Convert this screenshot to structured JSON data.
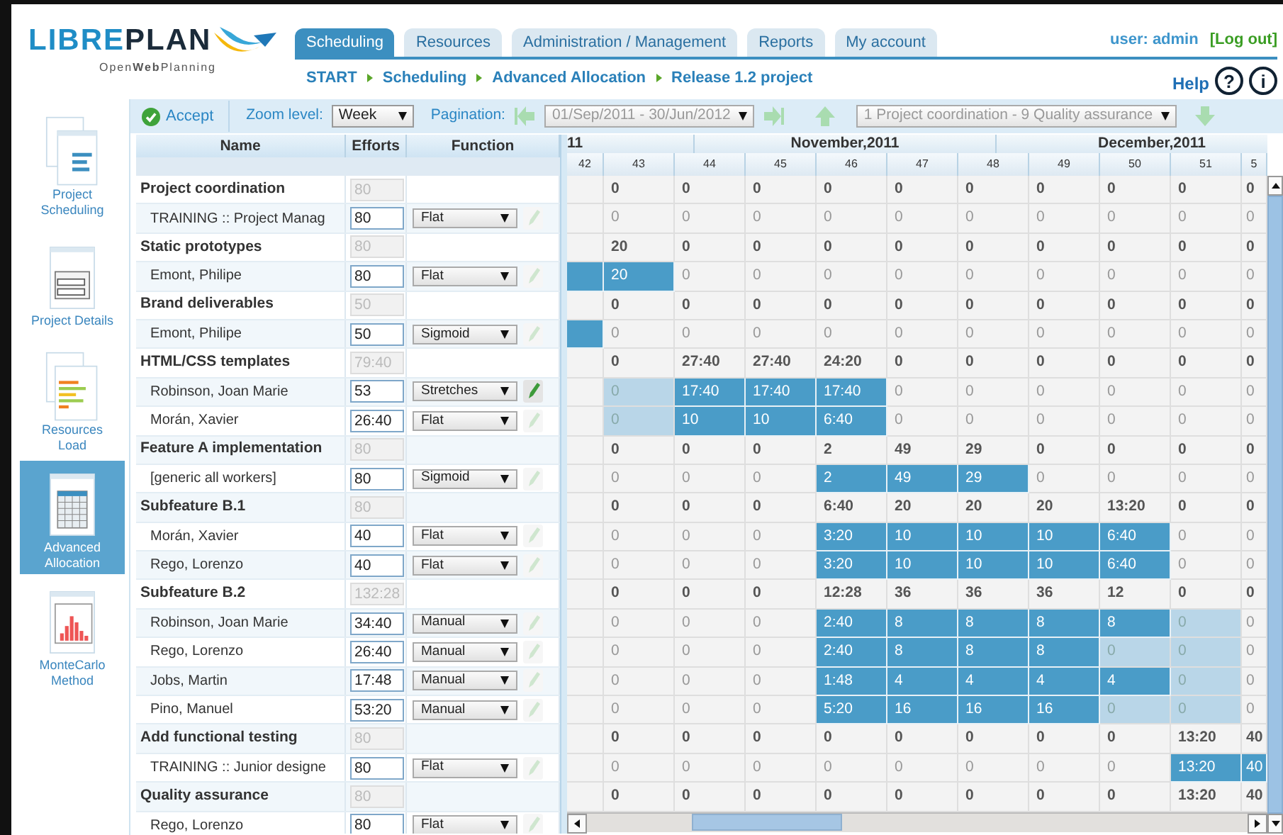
{
  "header": {
    "logo": {
      "part1": "LIBRE",
      "part2": "PLAN",
      "tagline": "Open**Web**Planning"
    },
    "tabs": [
      {
        "label": "Scheduling",
        "selected": true
      },
      {
        "label": "Resources",
        "selected": false
      },
      {
        "label": "Administration / Management",
        "selected": false
      },
      {
        "label": "Reports",
        "selected": false
      },
      {
        "label": "My account",
        "selected": false
      }
    ],
    "breadcrumb": [
      "START",
      "Scheduling",
      "Advanced Allocation",
      "Release 1.2 project"
    ],
    "user": "user: admin",
    "logout": "[Log out]",
    "help": {
      "label": "Help",
      "buttons": [
        "?",
        "i"
      ]
    }
  },
  "sidebar": {
    "items": [
      {
        "label": "Project\nScheduling",
        "selected": false
      },
      {
        "label": "Project Details",
        "selected": false
      },
      {
        "label": "Resources\nLoad",
        "selected": false
      },
      {
        "label": "Advanced\nAllocation",
        "selected": true
      },
      {
        "label": "MonteCarlo\nMethod",
        "selected": false
      }
    ]
  },
  "toolbar": {
    "accept": "Accept",
    "zoom_label": "Zoom level:",
    "zoom_value": "Week",
    "pagination_label": "Pagination:",
    "date_range": "01/Sep/2011 - 30/Jun/2012",
    "task_range": "1 Project coordination - 9 Quality assurance"
  },
  "table": {
    "columns": [
      "Name",
      "Efforts",
      "Function"
    ],
    "rows": [
      {
        "kind": "task",
        "name": "Project coordination",
        "effort": "80",
        "cells": [
          {
            "kind": "plain"
          },
          {
            "text": "0",
            "kind": "plain"
          },
          {
            "text": "0",
            "kind": "plain"
          },
          {
            "text": "0",
            "kind": "plain"
          },
          {
            "text": "0",
            "kind": "plain"
          },
          {
            "text": "0",
            "kind": "plain"
          },
          {
            "text": "0",
            "kind": "plain"
          },
          {
            "text": "0",
            "kind": "plain"
          },
          {
            "text": "0",
            "kind": "plain"
          },
          {
            "text": "0",
            "kind": "plain"
          },
          {
            "text": "0",
            "kind": "plain"
          }
        ]
      },
      {
        "kind": "resource",
        "name": "TRAINING :: Project Manag",
        "effort": "80",
        "function": "Flat",
        "edit_enabled": false,
        "cells": [
          {
            "kind": "plain"
          },
          {
            "text": "0",
            "kind": "plain"
          },
          {
            "text": "0",
            "kind": "plain"
          },
          {
            "text": "0",
            "kind": "plain"
          },
          {
            "text": "0",
            "kind": "plain"
          },
          {
            "text": "0",
            "kind": "plain"
          },
          {
            "text": "0",
            "kind": "plain"
          },
          {
            "text": "0",
            "kind": "plain"
          },
          {
            "text": "0",
            "kind": "plain"
          },
          {
            "text": "0",
            "kind": "plain"
          },
          {
            "text": "0",
            "kind": "plain"
          }
        ]
      },
      {
        "kind": "task",
        "name": "Static prototypes",
        "effort": "80",
        "cells": [
          {
            "kind": "plain"
          },
          {
            "text": "20",
            "kind": "plain"
          },
          {
            "text": "0",
            "kind": "plain"
          },
          {
            "text": "0",
            "kind": "plain"
          },
          {
            "text": "0",
            "kind": "plain"
          },
          {
            "text": "0",
            "kind": "plain"
          },
          {
            "text": "0",
            "kind": "plain"
          },
          {
            "text": "0",
            "kind": "plain"
          },
          {
            "text": "0",
            "kind": "plain"
          },
          {
            "text": "0",
            "kind": "plain"
          },
          {
            "text": "0",
            "kind": "plain"
          }
        ]
      },
      {
        "kind": "resource",
        "name": "Emont, Philipe",
        "effort": "80",
        "function": "Flat",
        "edit_enabled": false,
        "cells": [
          {
            "kind": "assigned"
          },
          {
            "text": "20",
            "kind": "assigned"
          },
          {
            "text": "0",
            "kind": "plain"
          },
          {
            "text": "0",
            "kind": "plain"
          },
          {
            "text": "0",
            "kind": "plain"
          },
          {
            "text": "0",
            "kind": "plain"
          },
          {
            "text": "0",
            "kind": "plain"
          },
          {
            "text": "0",
            "kind": "plain"
          },
          {
            "text": "0",
            "kind": "plain"
          },
          {
            "text": "0",
            "kind": "plain"
          },
          {
            "text": "0",
            "kind": "plain"
          }
        ]
      },
      {
        "kind": "task",
        "name": "Brand deliverables",
        "effort": "50",
        "cells": [
          {
            "kind": "plain"
          },
          {
            "text": "0",
            "kind": "plain"
          },
          {
            "text": "0",
            "kind": "plain"
          },
          {
            "text": "0",
            "kind": "plain"
          },
          {
            "text": "0",
            "kind": "plain"
          },
          {
            "text": "0",
            "kind": "plain"
          },
          {
            "text": "0",
            "kind": "plain"
          },
          {
            "text": "0",
            "kind": "plain"
          },
          {
            "text": "0",
            "kind": "plain"
          },
          {
            "text": "0",
            "kind": "plain"
          },
          {
            "text": "0",
            "kind": "plain"
          }
        ]
      },
      {
        "kind": "resource",
        "name": "Emont, Philipe",
        "effort": "50",
        "function": "Sigmoid",
        "edit_enabled": false,
        "cells": [
          {
            "kind": "assigned"
          },
          {
            "text": "0",
            "kind": "plain"
          },
          {
            "text": "0",
            "kind": "plain"
          },
          {
            "text": "0",
            "kind": "plain"
          },
          {
            "text": "0",
            "kind": "plain"
          },
          {
            "text": "0",
            "kind": "plain"
          },
          {
            "text": "0",
            "kind": "plain"
          },
          {
            "text": "0",
            "kind": "plain"
          },
          {
            "text": "0",
            "kind": "plain"
          },
          {
            "text": "0",
            "kind": "plain"
          },
          {
            "text": "0",
            "kind": "plain"
          }
        ]
      },
      {
        "kind": "task",
        "name": "HTML/CSS templates",
        "effort": "79:40",
        "cells": [
          {
            "kind": "plain"
          },
          {
            "text": "0",
            "kind": "plain"
          },
          {
            "text": "27:40",
            "kind": "plain"
          },
          {
            "text": "27:40",
            "kind": "plain"
          },
          {
            "text": "24:20",
            "kind": "plain"
          },
          {
            "text": "0",
            "kind": "plain"
          },
          {
            "text": "0",
            "kind": "plain"
          },
          {
            "text": "0",
            "kind": "plain"
          },
          {
            "text": "0",
            "kind": "plain"
          },
          {
            "text": "0",
            "kind": "plain"
          },
          {
            "text": "0",
            "kind": "plain"
          }
        ]
      },
      {
        "kind": "resource",
        "name": "Robinson, Joan Marie",
        "effort": "53",
        "function": "Stretches",
        "edit_enabled": true,
        "cells": [
          {
            "kind": "plain"
          },
          {
            "text": "0",
            "kind": "shaded"
          },
          {
            "text": "17:40",
            "kind": "assigned"
          },
          {
            "text": "17:40",
            "kind": "assigned"
          },
          {
            "text": "17:40",
            "kind": "assigned"
          },
          {
            "text": "0",
            "kind": "plain"
          },
          {
            "text": "0",
            "kind": "plain"
          },
          {
            "text": "0",
            "kind": "plain"
          },
          {
            "text": "0",
            "kind": "plain"
          },
          {
            "text": "0",
            "kind": "plain"
          },
          {
            "text": "0",
            "kind": "plain"
          }
        ]
      },
      {
        "kind": "resource",
        "name": "Morán, Xavier",
        "effort": "26:40",
        "function": "Flat",
        "edit_enabled": false,
        "cells": [
          {
            "kind": "plain"
          },
          {
            "text": "0",
            "kind": "shaded"
          },
          {
            "text": "10",
            "kind": "assigned"
          },
          {
            "text": "10",
            "kind": "assigned"
          },
          {
            "text": "6:40",
            "kind": "assigned"
          },
          {
            "text": "0",
            "kind": "plain"
          },
          {
            "text": "0",
            "kind": "plain"
          },
          {
            "text": "0",
            "kind": "plain"
          },
          {
            "text": "0",
            "kind": "plain"
          },
          {
            "text": "0",
            "kind": "plain"
          },
          {
            "text": "0",
            "kind": "plain"
          }
        ]
      },
      {
        "kind": "task",
        "name": "Feature A implementation",
        "effort": "80",
        "cells": [
          {
            "kind": "plain"
          },
          {
            "text": "0",
            "kind": "plain"
          },
          {
            "text": "0",
            "kind": "plain"
          },
          {
            "text": "0",
            "kind": "plain"
          },
          {
            "text": "2",
            "kind": "plain"
          },
          {
            "text": "49",
            "kind": "plain"
          },
          {
            "text": "29",
            "kind": "plain"
          },
          {
            "text": "0",
            "kind": "plain"
          },
          {
            "text": "0",
            "kind": "plain"
          },
          {
            "text": "0",
            "kind": "plain"
          },
          {
            "text": "0",
            "kind": "plain"
          }
        ]
      },
      {
        "kind": "resource",
        "name": "[generic all workers]",
        "effort": "80",
        "function": "Sigmoid",
        "edit_enabled": false,
        "cells": [
          {
            "kind": "plain"
          },
          {
            "text": "0",
            "kind": "plain"
          },
          {
            "text": "0",
            "kind": "plain"
          },
          {
            "text": "0",
            "kind": "plain"
          },
          {
            "text": "2",
            "kind": "assigned"
          },
          {
            "text": "49",
            "kind": "assigned"
          },
          {
            "text": "29",
            "kind": "assigned"
          },
          {
            "text": "0",
            "kind": "plain"
          },
          {
            "text": "0",
            "kind": "plain"
          },
          {
            "text": "0",
            "kind": "plain"
          },
          {
            "text": "0",
            "kind": "plain"
          }
        ]
      },
      {
        "kind": "task",
        "name": "Subfeature B.1",
        "effort": "80",
        "cells": [
          {
            "kind": "plain"
          },
          {
            "text": "0",
            "kind": "plain"
          },
          {
            "text": "0",
            "kind": "plain"
          },
          {
            "text": "0",
            "kind": "plain"
          },
          {
            "text": "6:40",
            "kind": "plain"
          },
          {
            "text": "20",
            "kind": "plain"
          },
          {
            "text": "20",
            "kind": "plain"
          },
          {
            "text": "20",
            "kind": "plain"
          },
          {
            "text": "13:20",
            "kind": "plain"
          },
          {
            "text": "0",
            "kind": "plain"
          },
          {
            "text": "0",
            "kind": "plain"
          }
        ]
      },
      {
        "kind": "resource",
        "name": "Morán, Xavier",
        "effort": "40",
        "function": "Flat",
        "edit_enabled": false,
        "cells": [
          {
            "kind": "plain"
          },
          {
            "text": "0",
            "kind": "plain"
          },
          {
            "text": "0",
            "kind": "plain"
          },
          {
            "text": "0",
            "kind": "plain"
          },
          {
            "text": "3:20",
            "kind": "assigned"
          },
          {
            "text": "10",
            "kind": "assigned"
          },
          {
            "text": "10",
            "kind": "assigned"
          },
          {
            "text": "10",
            "kind": "assigned"
          },
          {
            "text": "6:40",
            "kind": "assigned"
          },
          {
            "text": "0",
            "kind": "plain"
          },
          {
            "text": "0",
            "kind": "plain"
          }
        ]
      },
      {
        "kind": "resource",
        "name": "Rego, Lorenzo",
        "effort": "40",
        "function": "Flat",
        "edit_enabled": false,
        "cells": [
          {
            "kind": "plain"
          },
          {
            "text": "0",
            "kind": "plain"
          },
          {
            "text": "0",
            "kind": "plain"
          },
          {
            "text": "0",
            "kind": "plain"
          },
          {
            "text": "3:20",
            "kind": "assigned"
          },
          {
            "text": "10",
            "kind": "assigned"
          },
          {
            "text": "10",
            "kind": "assigned"
          },
          {
            "text": "10",
            "kind": "assigned"
          },
          {
            "text": "6:40",
            "kind": "assigned"
          },
          {
            "text": "0",
            "kind": "plain"
          },
          {
            "text": "0",
            "kind": "plain"
          }
        ]
      },
      {
        "kind": "task",
        "name": "Subfeature B.2",
        "effort": "132:28",
        "cells": [
          {
            "kind": "plain"
          },
          {
            "text": "0",
            "kind": "plain"
          },
          {
            "text": "0",
            "kind": "plain"
          },
          {
            "text": "0",
            "kind": "plain"
          },
          {
            "text": "12:28",
            "kind": "plain"
          },
          {
            "text": "36",
            "kind": "plain"
          },
          {
            "text": "36",
            "kind": "plain"
          },
          {
            "text": "36",
            "kind": "plain"
          },
          {
            "text": "12",
            "kind": "plain"
          },
          {
            "text": "0",
            "kind": "plain"
          },
          {
            "text": "0",
            "kind": "plain"
          }
        ]
      },
      {
        "kind": "resource",
        "name": "Robinson, Joan Marie",
        "effort": "34:40",
        "function": "Manual",
        "edit_enabled": false,
        "cells": [
          {
            "kind": "plain"
          },
          {
            "text": "0",
            "kind": "plain"
          },
          {
            "text": "0",
            "kind": "plain"
          },
          {
            "text": "0",
            "kind": "plain"
          },
          {
            "text": "2:40",
            "kind": "assigned"
          },
          {
            "text": "8",
            "kind": "assigned"
          },
          {
            "text": "8",
            "kind": "assigned"
          },
          {
            "text": "8",
            "kind": "assigned"
          },
          {
            "text": "8",
            "kind": "assigned"
          },
          {
            "text": "0",
            "kind": "shaded"
          },
          {
            "text": "0",
            "kind": "plain"
          }
        ]
      },
      {
        "kind": "resource",
        "name": "Rego, Lorenzo",
        "effort": "26:40",
        "function": "Manual",
        "edit_enabled": false,
        "cells": [
          {
            "kind": "plain"
          },
          {
            "text": "0",
            "kind": "plain"
          },
          {
            "text": "0",
            "kind": "plain"
          },
          {
            "text": "0",
            "kind": "plain"
          },
          {
            "text": "2:40",
            "kind": "assigned"
          },
          {
            "text": "8",
            "kind": "assigned"
          },
          {
            "text": "8",
            "kind": "assigned"
          },
          {
            "text": "8",
            "kind": "assigned"
          },
          {
            "text": "0",
            "kind": "shaded"
          },
          {
            "text": "0",
            "kind": "shaded"
          },
          {
            "text": "0",
            "kind": "plain"
          }
        ]
      },
      {
        "kind": "resource",
        "name": "Jobs, Martin",
        "effort": "17:48",
        "function": "Manual",
        "edit_enabled": false,
        "cells": [
          {
            "kind": "plain"
          },
          {
            "text": "0",
            "kind": "plain"
          },
          {
            "text": "0",
            "kind": "plain"
          },
          {
            "text": "0",
            "kind": "plain"
          },
          {
            "text": "1:48",
            "kind": "assigned"
          },
          {
            "text": "4",
            "kind": "assigned"
          },
          {
            "text": "4",
            "kind": "assigned"
          },
          {
            "text": "4",
            "kind": "assigned"
          },
          {
            "text": "4",
            "kind": "assigned"
          },
          {
            "text": "0",
            "kind": "shaded"
          },
          {
            "text": "0",
            "kind": "plain"
          }
        ]
      },
      {
        "kind": "resource",
        "name": "Pino, Manuel",
        "effort": "53:20",
        "function": "Manual",
        "edit_enabled": false,
        "cells": [
          {
            "kind": "plain"
          },
          {
            "text": "0",
            "kind": "plain"
          },
          {
            "text": "0",
            "kind": "plain"
          },
          {
            "text": "0",
            "kind": "plain"
          },
          {
            "text": "5:20",
            "kind": "assigned"
          },
          {
            "text": "16",
            "kind": "assigned"
          },
          {
            "text": "16",
            "kind": "assigned"
          },
          {
            "text": "16",
            "kind": "assigned"
          },
          {
            "text": "0",
            "kind": "shaded"
          },
          {
            "text": "0",
            "kind": "shaded"
          },
          {
            "text": "0",
            "kind": "plain"
          }
        ]
      },
      {
        "kind": "task",
        "name": "Add functional testing",
        "effort": "80",
        "cells": [
          {
            "kind": "plain"
          },
          {
            "text": "0",
            "kind": "plain"
          },
          {
            "text": "0",
            "kind": "plain"
          },
          {
            "text": "0",
            "kind": "plain"
          },
          {
            "text": "0",
            "kind": "plain"
          },
          {
            "text": "0",
            "kind": "plain"
          },
          {
            "text": "0",
            "kind": "plain"
          },
          {
            "text": "0",
            "kind": "plain"
          },
          {
            "text": "0",
            "kind": "plain"
          },
          {
            "text": "13:20",
            "kind": "plain"
          },
          {
            "text": "40",
            "kind": "plain"
          }
        ]
      },
      {
        "kind": "resource",
        "name": "TRAINING :: Junior designe",
        "effort": "80",
        "function": "Flat",
        "edit_enabled": false,
        "cells": [
          {
            "kind": "plain"
          },
          {
            "text": "0",
            "kind": "plain"
          },
          {
            "text": "0",
            "kind": "plain"
          },
          {
            "text": "0",
            "kind": "plain"
          },
          {
            "text": "0",
            "kind": "plain"
          },
          {
            "text": "0",
            "kind": "plain"
          },
          {
            "text": "0",
            "kind": "plain"
          },
          {
            "text": "0",
            "kind": "plain"
          },
          {
            "text": "0",
            "kind": "plain"
          },
          {
            "text": "13:20",
            "kind": "assigned"
          },
          {
            "text": "40",
            "kind": "assigned"
          }
        ]
      },
      {
        "kind": "task",
        "name": "Quality assurance",
        "effort": "80",
        "cells": [
          {
            "kind": "plain"
          },
          {
            "text": "0",
            "kind": "plain"
          },
          {
            "text": "0",
            "kind": "plain"
          },
          {
            "text": "0",
            "kind": "plain"
          },
          {
            "text": "0",
            "kind": "plain"
          },
          {
            "text": "0",
            "kind": "plain"
          },
          {
            "text": "0",
            "kind": "plain"
          },
          {
            "text": "0",
            "kind": "plain"
          },
          {
            "text": "0",
            "kind": "plain"
          },
          {
            "text": "13:20",
            "kind": "plain"
          },
          {
            "text": "40",
            "kind": "plain"
          }
        ]
      },
      {
        "kind": "resource",
        "name": "Rego, Lorenzo",
        "effort": "80",
        "function": "Flat",
        "edit_enabled": false
      }
    ]
  },
  "timeline": {
    "months": [
      "11",
      "November,2011",
      "December,2011"
    ],
    "weeks": [
      "42",
      "43",
      "44",
      "45",
      "46",
      "47",
      "48",
      "49",
      "50",
      "51",
      "5"
    ]
  }
}
